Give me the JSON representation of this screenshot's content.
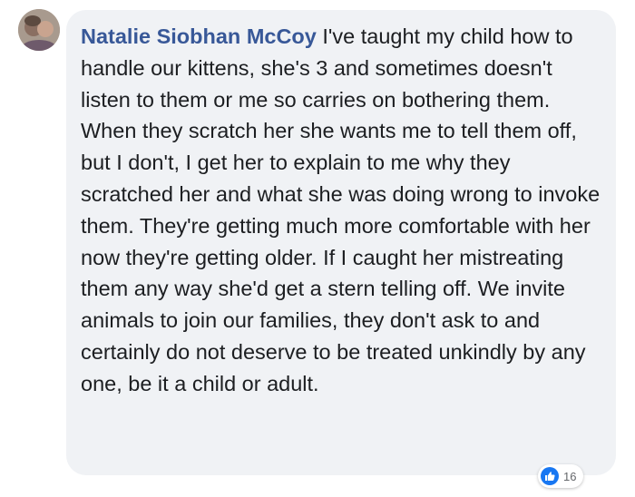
{
  "comment": {
    "author": "Natalie Siobhan McCoy",
    "text": "I've taught my child how to handle our kittens, she's 3 and sometimes doesn't listen to them or me so carries on bothering them. When they scratch her she wants me to tell them off, but I don't, I get her to explain to me why they scratched her and what she was doing wrong to invoke them. They're getting much more comfortable with her now they're getting older. If I caught her mistreating them any way she'd get a stern telling off. We invite animals to join our families, they don't ask to and certainly do not deserve to be treated unkindly by any one, be it a child or adult.",
    "reaction_icon": "like-icon",
    "reaction_count": "16"
  },
  "colors": {
    "author": "#385898",
    "bubble": "#f0f2f5",
    "text": "#1c1e21",
    "like": "#1877f2"
  }
}
